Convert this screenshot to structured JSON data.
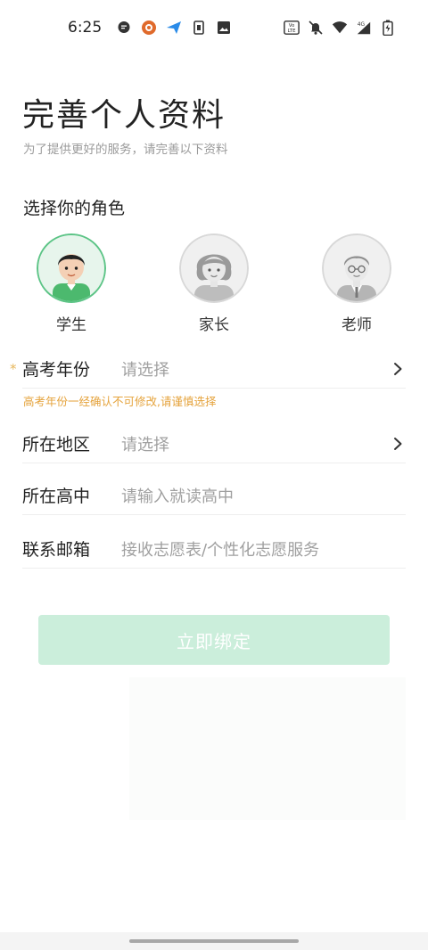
{
  "status_bar": {
    "time": "6:25",
    "left_icons": [
      "message-icon",
      "app-icon",
      "send-icon",
      "sim-icon",
      "image-icon"
    ],
    "right_icons": [
      "volte-icon",
      "mute-icon",
      "wifi-icon",
      "signal-4g-icon",
      "battery-icon"
    ],
    "volte_text": "Vo LTE",
    "network_text": "4G"
  },
  "header": {
    "title": "完善个人资料",
    "subtitle": "为了提供更好的服务，请完善以下资料"
  },
  "role_section": {
    "heading": "选择你的角色",
    "roles": [
      {
        "label": "学生",
        "selected": true
      },
      {
        "label": "家长",
        "selected": false
      },
      {
        "label": "老师",
        "selected": false
      }
    ]
  },
  "form": {
    "year": {
      "label": "高考年份",
      "value": "请选择",
      "required_mark": "*"
    },
    "year_note": "高考年份一经确认不可修改,请谨慎选择",
    "region": {
      "label": "所在地区",
      "value": "请选择"
    },
    "school": {
      "label": "所在高中",
      "placeholder": "请输入就读高中"
    },
    "email": {
      "label": "联系邮箱",
      "placeholder": "接收志愿表/个性化志愿服务"
    }
  },
  "submit": {
    "label": "立即绑定"
  },
  "colors": {
    "accent": "#3dba6f",
    "button_disabled": "#cbeedb",
    "warning": "#e5a33c",
    "placeholder": "#a0a0a0"
  }
}
